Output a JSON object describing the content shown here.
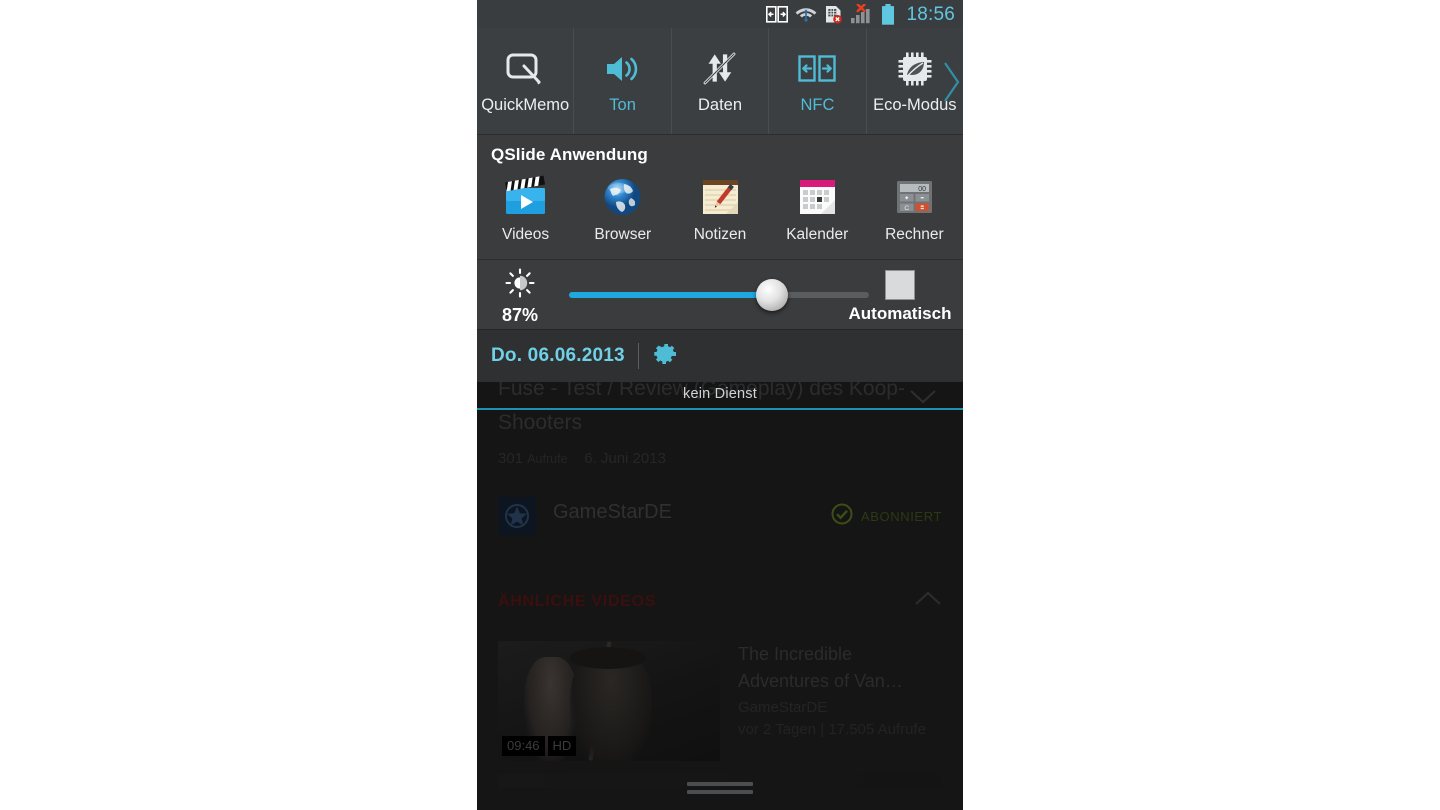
{
  "statusbar": {
    "icons": [
      "screen-share-icon",
      "wifi-icon",
      "sim-card-error-icon",
      "signal-no-service-icon",
      "battery-icon"
    ],
    "time": "18:56"
  },
  "toggles": {
    "expand_arrow": "chevron-right-icon",
    "items": [
      {
        "label": "QuickMemo",
        "icon": "quickmemo-icon",
        "active": false
      },
      {
        "label": "Ton",
        "icon": "sound-icon",
        "active": true
      },
      {
        "label": "Daten",
        "icon": "data-off-icon",
        "active": false
      },
      {
        "label": "NFC",
        "icon": "nfc-icon",
        "active": true
      },
      {
        "label": "Eco-Modus",
        "icon": "eco-mode-icon",
        "active": false
      }
    ]
  },
  "qslide": {
    "title": "QSlide Anwendung",
    "apps": [
      {
        "label": "Videos",
        "icon": "videos-icon"
      },
      {
        "label": "Browser",
        "icon": "browser-globe-icon"
      },
      {
        "label": "Notizen",
        "icon": "notes-icon"
      },
      {
        "label": "Kalender",
        "icon": "calendar-icon"
      },
      {
        "label": "Rechner",
        "icon": "calculator-icon"
      }
    ]
  },
  "brightness": {
    "icon": "brightness-sun-icon",
    "percent_label": "87%",
    "value": 87,
    "auto_label": "Automatisch",
    "auto_checked": false
  },
  "datebar": {
    "date": "Do. 06.06.2013",
    "settings_icon": "gear-icon"
  },
  "toast": {
    "text": "kein Dienst"
  },
  "content": {
    "video": {
      "title": "Fuse - Test / Review (Gameplay) des Koop-Shooters",
      "views": "301",
      "views_unit": "Aufrufe",
      "date": "6. Juni 2013",
      "collapse_icon": "chevron-down-icon",
      "channel": "GameStarDE",
      "channel_avatar": "star-badge-icon",
      "subscribed_label": "ABONNIERT",
      "subscribed_icon": "check-circle-icon"
    },
    "related": {
      "section_title": "ÄHNLICHE VIDEOS",
      "collapse_icon": "chevron-up-icon",
      "items": [
        {
          "title": "The Incredible Adventures of Van…",
          "channel": "GameStarDE",
          "meta": "vor 2 Tagen | 17.505 Aufrufe",
          "duration": "09:46",
          "quality": "HD"
        }
      ]
    }
  },
  "bottom": {
    "grip": "drag-handle"
  },
  "colors": {
    "accent_cyan": "#4fbcd6",
    "date_cyan": "#6fd0e6",
    "slider_blue": "#1fa7e0",
    "panel_gray": "#3c3f41",
    "statusbar_gray": "#3a3d40"
  }
}
